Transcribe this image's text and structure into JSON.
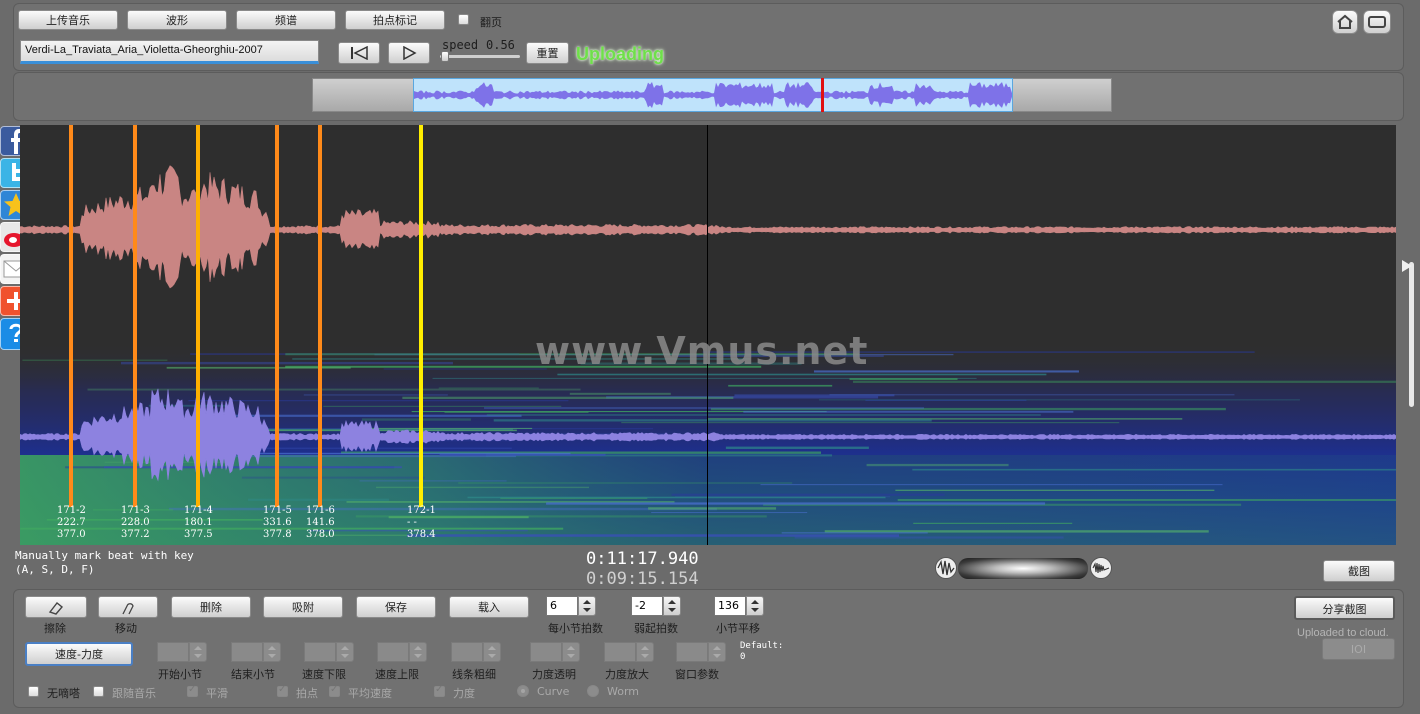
{
  "toolbar": {
    "upload_music": "上传音乐",
    "waveform": "波形",
    "spectrum": "频谱",
    "beat_mark": "拍点标记",
    "page_flip": "翻页",
    "track_name": "Verdi-La_Traviata_Aria_Violetta-Gheorghiu-2007",
    "speed_label": "speed",
    "speed_value": "0.56",
    "speed_fraction": 0.02,
    "reset": "重置",
    "status": "Uploading"
  },
  "watermark": "www.Vmus.net",
  "beats": [
    {
      "label": "171-2",
      "v1": "222.7",
      "v2": "377.0",
      "color": "#ff8a1a"
    },
    {
      "label": "171-3",
      "v1": "228.0",
      "v2": "377.2",
      "color": "#ff8a1a"
    },
    {
      "label": "171-4",
      "v1": "180.1",
      "v2": "377.5",
      "color": "#ffb000"
    },
    {
      "label": "171-5",
      "v1": "331.6",
      "v2": "377.8",
      "color": "#ff8a1a"
    },
    {
      "label": "171-6",
      "v1": "141.6",
      "v2": "378.0",
      "color": "#ff8a1a"
    },
    {
      "label": "172-1",
      "v1": "- -",
      "v2": "378.4",
      "color": "#ffee00"
    }
  ],
  "hint": {
    "line1": "Manually mark beat with key",
    "line2": "(A, S, D, F)"
  },
  "time": {
    "current": "0:11:17.940",
    "total": "0:09:15.154"
  },
  "screenshot": "截图",
  "tools": {
    "erase": "擦除",
    "move": "移动",
    "delete": "删除",
    "snap": "吸附",
    "save": "保存",
    "load": "载入"
  },
  "spinners": {
    "beats_per_bar": {
      "value": "6",
      "label": "每小节拍数"
    },
    "pickup": {
      "value": "-2",
      "label": "弱起拍数"
    },
    "bar_offset": {
      "value": "136",
      "label": "小节平移"
    }
  },
  "share": "分享截图",
  "uploaded": "Uploaded to cloud.",
  "ioi": "IOI",
  "tempo_dynamics": "速度-力度",
  "params": {
    "start_bar": "开始小节",
    "end_bar": "结束小节",
    "tempo_min": "速度下限",
    "tempo_max": "速度上限",
    "line_width": "线条粗细",
    "dyn_alpha": "力度透明",
    "dyn_zoom": "力度放大",
    "window": "窗口参数",
    "default_label": "Default:",
    "default_value": "0"
  },
  "options": {
    "no_tick": "无嘀嗒",
    "follow": "跟随音乐",
    "smooth": "平滑",
    "beat": "拍点",
    "avg_tempo": "平均速度",
    "dynamics": "力度",
    "curve": "Curve",
    "worm": "Worm"
  },
  "colors": {
    "accent": "#6fe04a",
    "beat_orange": "#ff8a1a",
    "beat_yellow": "#ffee00",
    "wave_top": "#c98583",
    "wave_bottom": "#8d82e0"
  }
}
